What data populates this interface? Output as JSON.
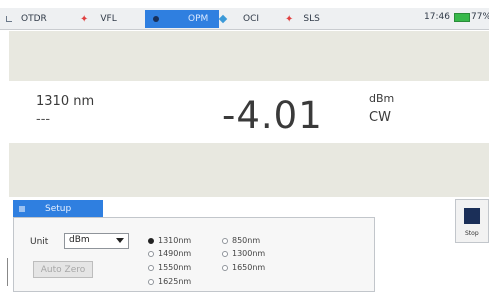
{
  "tabs": [
    {
      "label": "OTDR",
      "icon": "otdr-icon",
      "active": false
    },
    {
      "label": "VFL",
      "icon": "vfl-icon",
      "active": false
    },
    {
      "label": "OPM",
      "icon": "opm-icon",
      "active": true
    },
    {
      "label": "OCI",
      "icon": "oci-icon",
      "active": false
    },
    {
      "label": "SLS",
      "icon": "sls-icon",
      "active": false
    }
  ],
  "status": {
    "time": "17:46",
    "battery": "77%"
  },
  "reading": {
    "wavelength": "1310 nm",
    "secondary": "---",
    "value": "-4.01",
    "unit": "dBm",
    "mode": "CW"
  },
  "setup": {
    "tab_label": "Setup",
    "unit_label": "Unit",
    "unit_value": "dBm",
    "auto_zero_label": "Auto Zero",
    "wavelengths": [
      {
        "label": "1310nm",
        "selected": true
      },
      {
        "label": "850nm",
        "selected": false
      },
      {
        "label": "1490nm",
        "selected": false
      },
      {
        "label": "1300nm",
        "selected": false
      },
      {
        "label": "1550nm",
        "selected": false
      },
      {
        "label": "1650nm",
        "selected": false
      },
      {
        "label": "1625nm",
        "selected": false
      }
    ]
  },
  "stop_label": "Stop",
  "colors": {
    "accent": "#2f7fe0",
    "stop_square": "#1b2f58",
    "battery": "#37b84a"
  }
}
